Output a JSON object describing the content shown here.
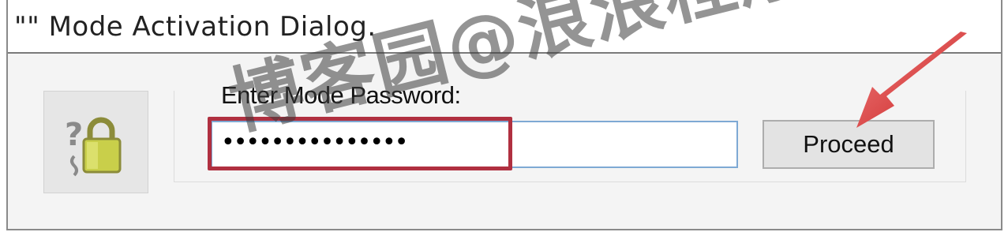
{
  "window": {
    "title": "\"\" Mode Activation Dialog."
  },
  "form": {
    "password_label": "Enter Mode Password:",
    "password_value": "•••••••••••••••",
    "proceed_label": "Proceed"
  },
  "icons": {
    "lock": "lock-question-icon",
    "arrow": "arrow-annotation-icon"
  },
  "watermark": {
    "text": "博客园@浪浪程序员"
  },
  "colors": {
    "highlight_box": "#b03040",
    "arrow": "#d62828",
    "field_border": "#7ea9d4",
    "lock_body": "#c9cf4a"
  }
}
